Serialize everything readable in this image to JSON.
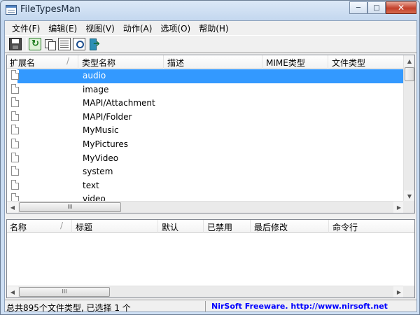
{
  "window": {
    "title": "FileTypesMan",
    "minimize_glyph": "─",
    "maximize_glyph": "□",
    "close_glyph": "✕"
  },
  "menu": [
    "文件(F)",
    "编辑(E)",
    "视图(V)",
    "动作(A)",
    "选项(O)",
    "帮助(H)"
  ],
  "toolbar": {
    "icons": [
      "save-icon",
      "refresh-icon",
      "copy-icon",
      "properties-icon",
      "find-icon",
      "exit-icon"
    ]
  },
  "top_table": {
    "columns": [
      "扩展名",
      "类型名称",
      "描述",
      "MIME类型",
      "文件类型"
    ],
    "sort_indicator": "/",
    "rows": [
      "audio",
      "image",
      "MAPI/Attachment",
      "MAPI/Folder",
      "MyMusic",
      "MyPictures",
      "MyVideo",
      "system",
      "text",
      "video"
    ],
    "selected_index": 0,
    "scroll_glyphs": {
      "up": "▲",
      "down": "▼",
      "left": "◀",
      "right": "▶",
      "grip": "III"
    }
  },
  "bottom_table": {
    "columns": [
      "名称",
      "标题",
      "默认",
      "已禁用",
      "最后修改",
      "命令行"
    ],
    "sort_indicator": "/"
  },
  "status": {
    "left": "总共895个文件类型, 已选择 1 个",
    "right": "NirSoft Freeware.  http://www.nirsoft.net"
  },
  "colors": {
    "selection": "#3399ff",
    "link": "#0000ff"
  }
}
